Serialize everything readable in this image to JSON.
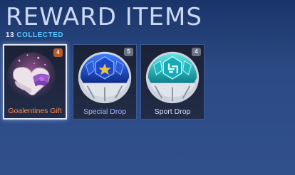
{
  "header": {
    "title": "REWARD ITEMS",
    "collected_count": "13",
    "collected_label": "COLLECTED"
  },
  "items": [
    {
      "name": "Goalentines Gift",
      "count": "4",
      "label_color": "#ff8a55",
      "badge_color": "#b55a2a",
      "selected": true
    },
    {
      "name": "Special Drop",
      "count": "5",
      "label_color": "#9fb6ff",
      "badge_color": "#6b7384",
      "selected": false
    },
    {
      "name": "Sport Drop",
      "count": "4",
      "label_color": "#d6e2f4",
      "badge_color": "#6b7384",
      "selected": false
    }
  ]
}
